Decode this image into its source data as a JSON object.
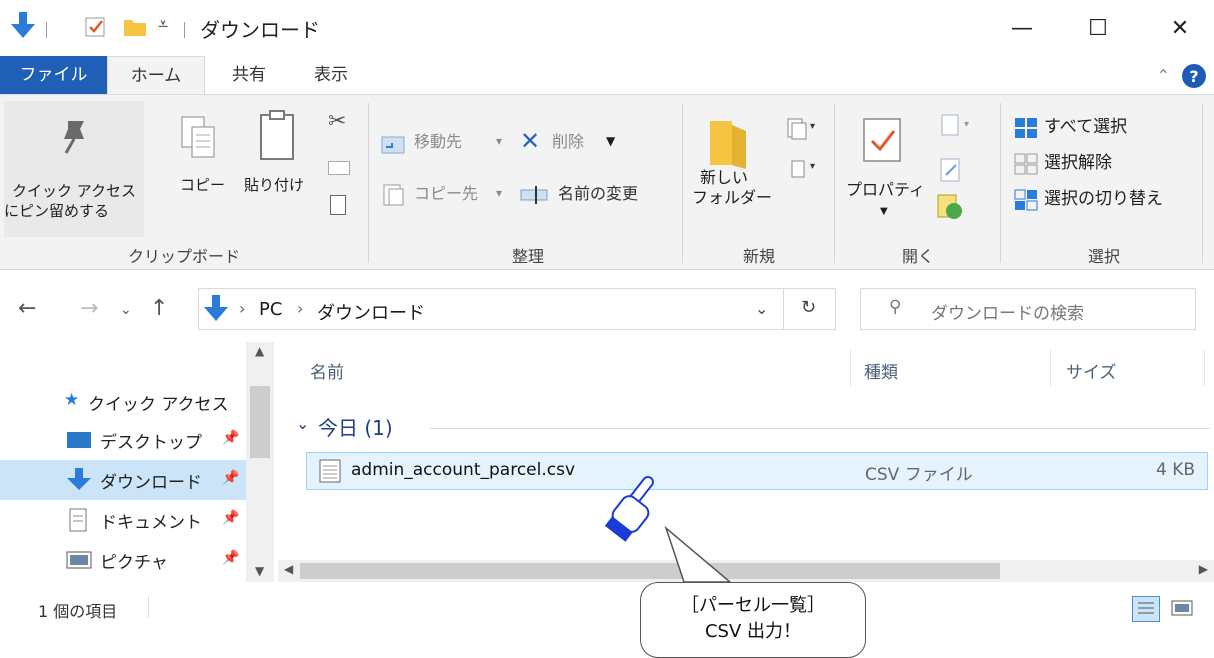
{
  "window": {
    "title": "ダウンロード",
    "minimize_glyph": "—",
    "maximize_glyph": "☐",
    "close_glyph": "✕"
  },
  "ribbon_tabs": [
    "ファイル",
    "ホーム",
    "共有",
    "表示"
  ],
  "ribbon": {
    "clipboard": {
      "pin_label_1": "クイック アクセス",
      "pin_label_2": "にピン留めする",
      "copy_label": "コピー",
      "paste_label": "貼り付け",
      "group_label": "クリップボード"
    },
    "organize": {
      "move_to": "移動先",
      "copy_to": "コピー先",
      "delete": "削除",
      "rename": "名前の変更",
      "group_label": "整理"
    },
    "new": {
      "new_folder_1": "新しい",
      "new_folder_2": "フォルダー",
      "group_label": "新規"
    },
    "open": {
      "properties": "プロパティ",
      "group_label": "開く"
    },
    "select": {
      "select_all": "すべて選択",
      "select_none": "選択解除",
      "invert": "選択の切り替え",
      "group_label": "選択"
    }
  },
  "address": {
    "crumbs": [
      "PC",
      "ダウンロード"
    ],
    "search_placeholder": "ダウンロードの検索"
  },
  "nav_pane": {
    "quick_access": "クイック アクセス",
    "items": [
      {
        "label": "デスクトップ",
        "icon": "desktop-icon"
      },
      {
        "label": "ダウンロード",
        "icon": "download-arrow-icon",
        "selected": true
      },
      {
        "label": "ドキュメント",
        "icon": "document-icon"
      },
      {
        "label": "ピクチャ",
        "icon": "pictures-icon"
      }
    ]
  },
  "file_list": {
    "columns": [
      "名前",
      "種類",
      "サイズ"
    ],
    "group_header": "今日 (1)",
    "rows": [
      {
        "name": "admin_account_parcel.csv",
        "type": "CSV ファイル",
        "size": "4 KB"
      }
    ]
  },
  "status_bar": {
    "item_count": "1 個の項目"
  },
  "callout": {
    "line1": "［パーセル一覧］",
    "line2": "CSV 出力！"
  },
  "colors": {
    "accent": "#1f5fb5",
    "selection": "#cce4f7",
    "row_highlight": "#e5f3ff",
    "download_arrow": "#2b7bd8"
  }
}
